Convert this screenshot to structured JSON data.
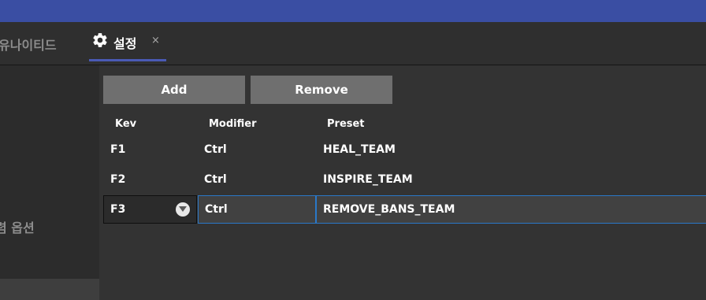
{
  "tabs": {
    "partial_label": "유나이티드",
    "active_label": "설정",
    "close_glyph": "×",
    "active_icon": "gear-icon"
  },
  "sidebar": {
    "partial_label": "렴 옵션"
  },
  "toolbar": {
    "add_label": "Add",
    "remove_label": "Remove"
  },
  "table": {
    "headers": [
      "Kev",
      "Modifier",
      "Preset"
    ],
    "rows": [
      {
        "key": "F1",
        "modifier": "Ctrl",
        "preset": "HEAL_TEAM"
      },
      {
        "key": "F2",
        "modifier": "Ctrl",
        "preset": "INSPIRE_TEAM"
      },
      {
        "key": "F3",
        "modifier": "Ctrl",
        "preset": "REMOVE_BANS_TEAM"
      }
    ],
    "selected_row": 2
  },
  "colors": {
    "titlebar": "#3a4ea3",
    "tab_underline": "#4a5ab5",
    "selection_border": "#2a78c8",
    "button_bg": "#6f6f6f"
  }
}
